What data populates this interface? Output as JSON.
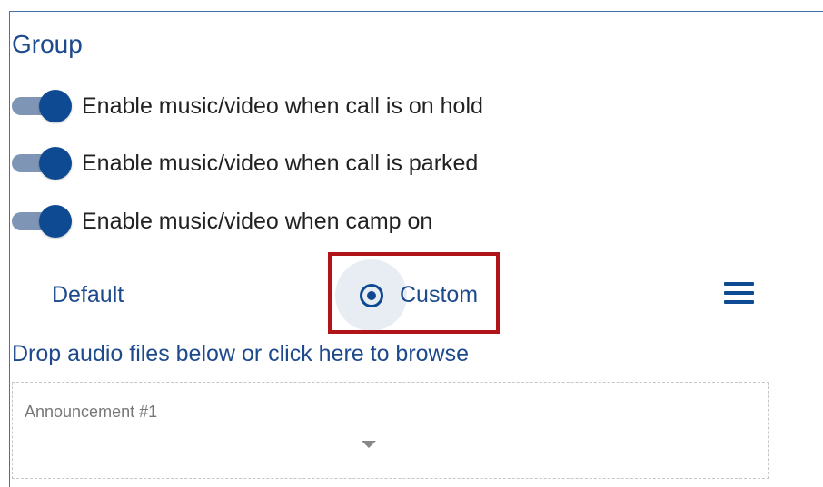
{
  "group": {
    "title": "Group"
  },
  "toggles": [
    {
      "label": "Enable music/video when call is on hold",
      "enabled": true
    },
    {
      "label": "Enable music/video when call is parked",
      "enabled": true
    },
    {
      "label": "Enable music/video when camp on",
      "enabled": true
    }
  ],
  "source_options": {
    "default_label": "Default",
    "custom_label": "Custom",
    "selected": "Custom",
    "menu_icon": "hamburger-menu-icon"
  },
  "upload": {
    "browse_text": "Drop audio files below or click here to browse"
  },
  "announcement": {
    "label": "Announcement #1",
    "value": ""
  },
  "colors": {
    "accent": "#0d4a92",
    "text_blue": "#1d4a8c",
    "highlight": "#b01419"
  }
}
